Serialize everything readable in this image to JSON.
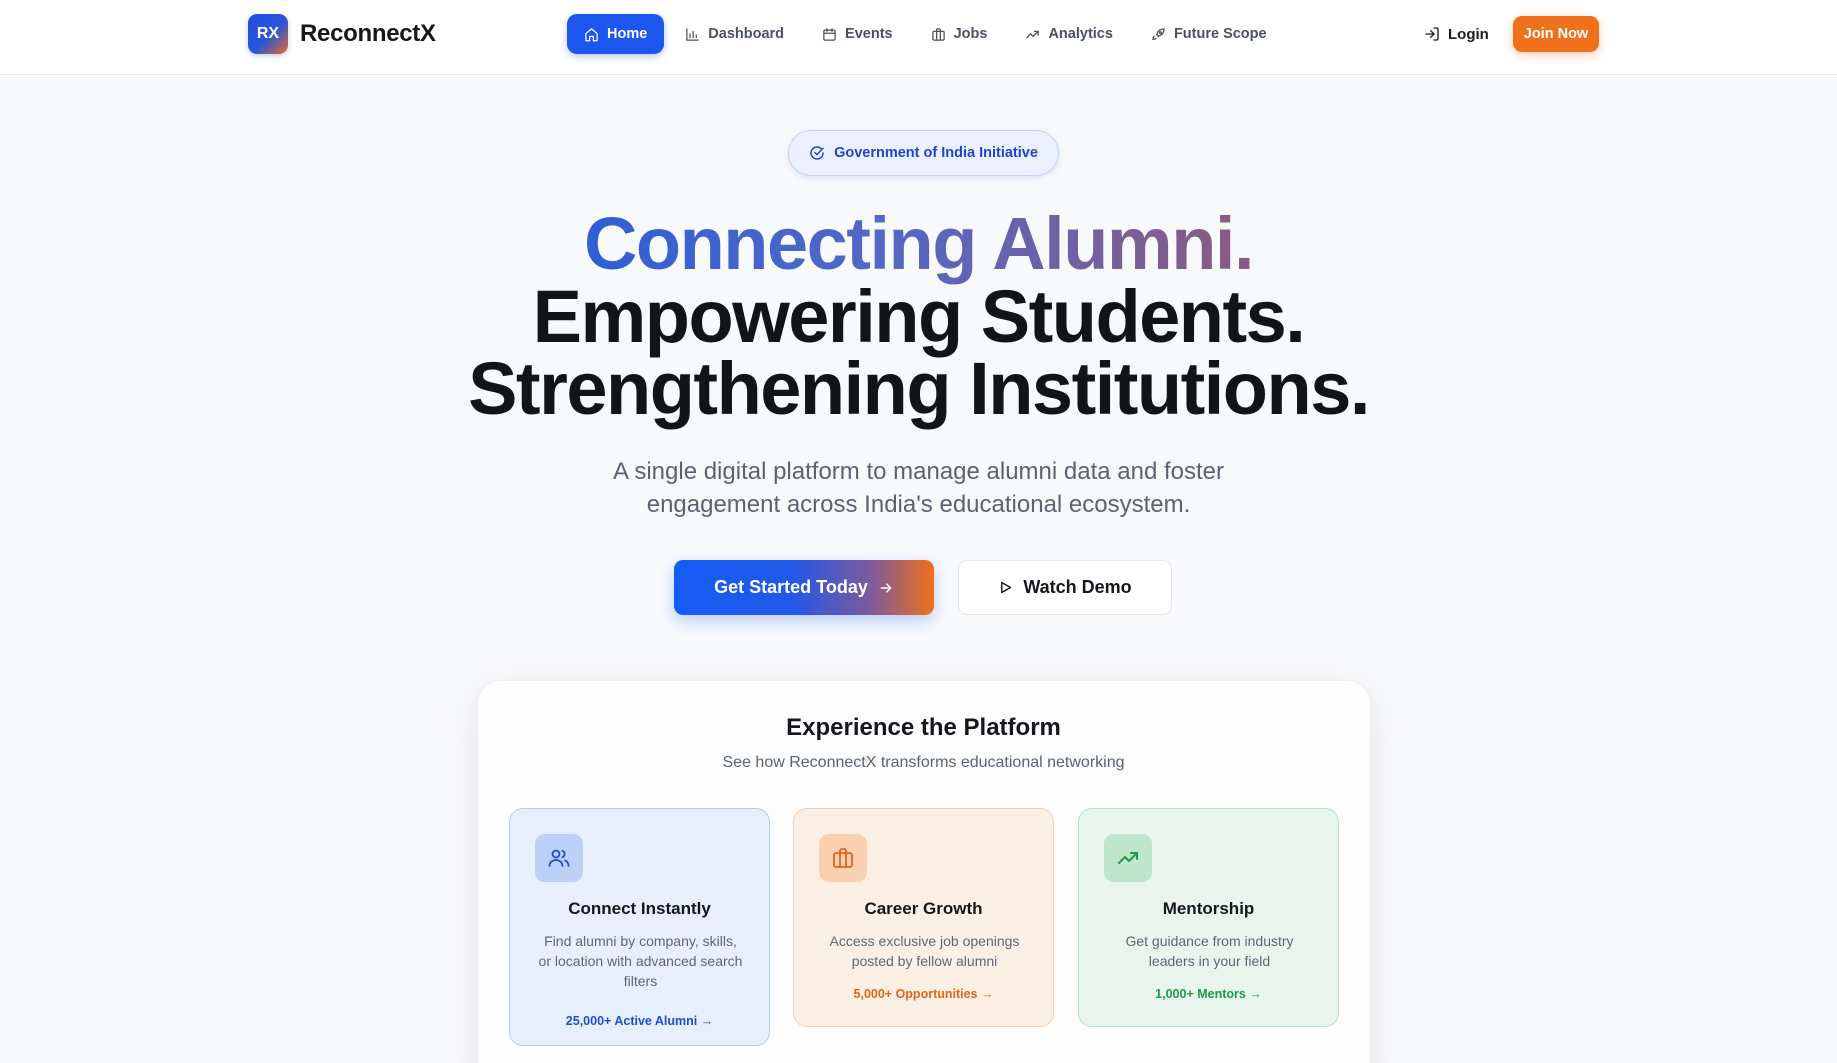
{
  "brand": {
    "logo_text": "RX",
    "name": "ReconnectX",
    "logo_colors": [
      "#1d4ee0",
      "#e96a22"
    ]
  },
  "nav": {
    "items": [
      {
        "label": "Home",
        "icon": "home-icon",
        "active": true
      },
      {
        "label": "Dashboard",
        "icon": "bar-chart-icon",
        "active": false
      },
      {
        "label": "Events",
        "icon": "calendar-icon",
        "active": false
      },
      {
        "label": "Jobs",
        "icon": "briefcase-icon",
        "active": false
      },
      {
        "label": "Analytics",
        "icon": "trending-up-icon",
        "active": false
      },
      {
        "label": "Future Scope",
        "icon": "rocket-icon",
        "active": false
      }
    ],
    "login_label": "Login",
    "join_label": "Join Now"
  },
  "badge": {
    "label": "Government of India Initiative",
    "icon": "check-circle-icon"
  },
  "hero": {
    "line1": "Connecting Alumni.",
    "line2": "Empowering Students.",
    "line3": "Strengthening Institutions.",
    "subtitle_line1": "A single digital platform to manage alumni data and foster",
    "subtitle_line2": "engagement across India's educational ecosystem.",
    "primary_cta": "Get Started Today",
    "secondary_cta": "Watch Demo"
  },
  "platform": {
    "title": "Experience the Platform",
    "subtitle": "See how ReconnectX transforms educational networking",
    "cards": [
      {
        "title": "Connect Instantly",
        "description": "Find alumni by company, skills, or location with advanced search filters",
        "stat": "25,000+ Active Alumni →",
        "icon": "users-icon",
        "accent": "#1d4fd0"
      },
      {
        "title": "Career Growth",
        "description": "Access exclusive job openings posted by fellow alumni",
        "stat": "5,000+ Opportunities →",
        "icon": "briefcase-icon",
        "accent": "#e2651a"
      },
      {
        "title": "Mentorship",
        "description": "Get guidance from industry leaders in your field",
        "stat": "1,000+ Mentors →",
        "icon": "trending-up-icon",
        "accent": "#1e9a4a"
      }
    ]
  },
  "colors": {
    "primary": "#1c56ee",
    "accent_orange": "#f0701c"
  }
}
